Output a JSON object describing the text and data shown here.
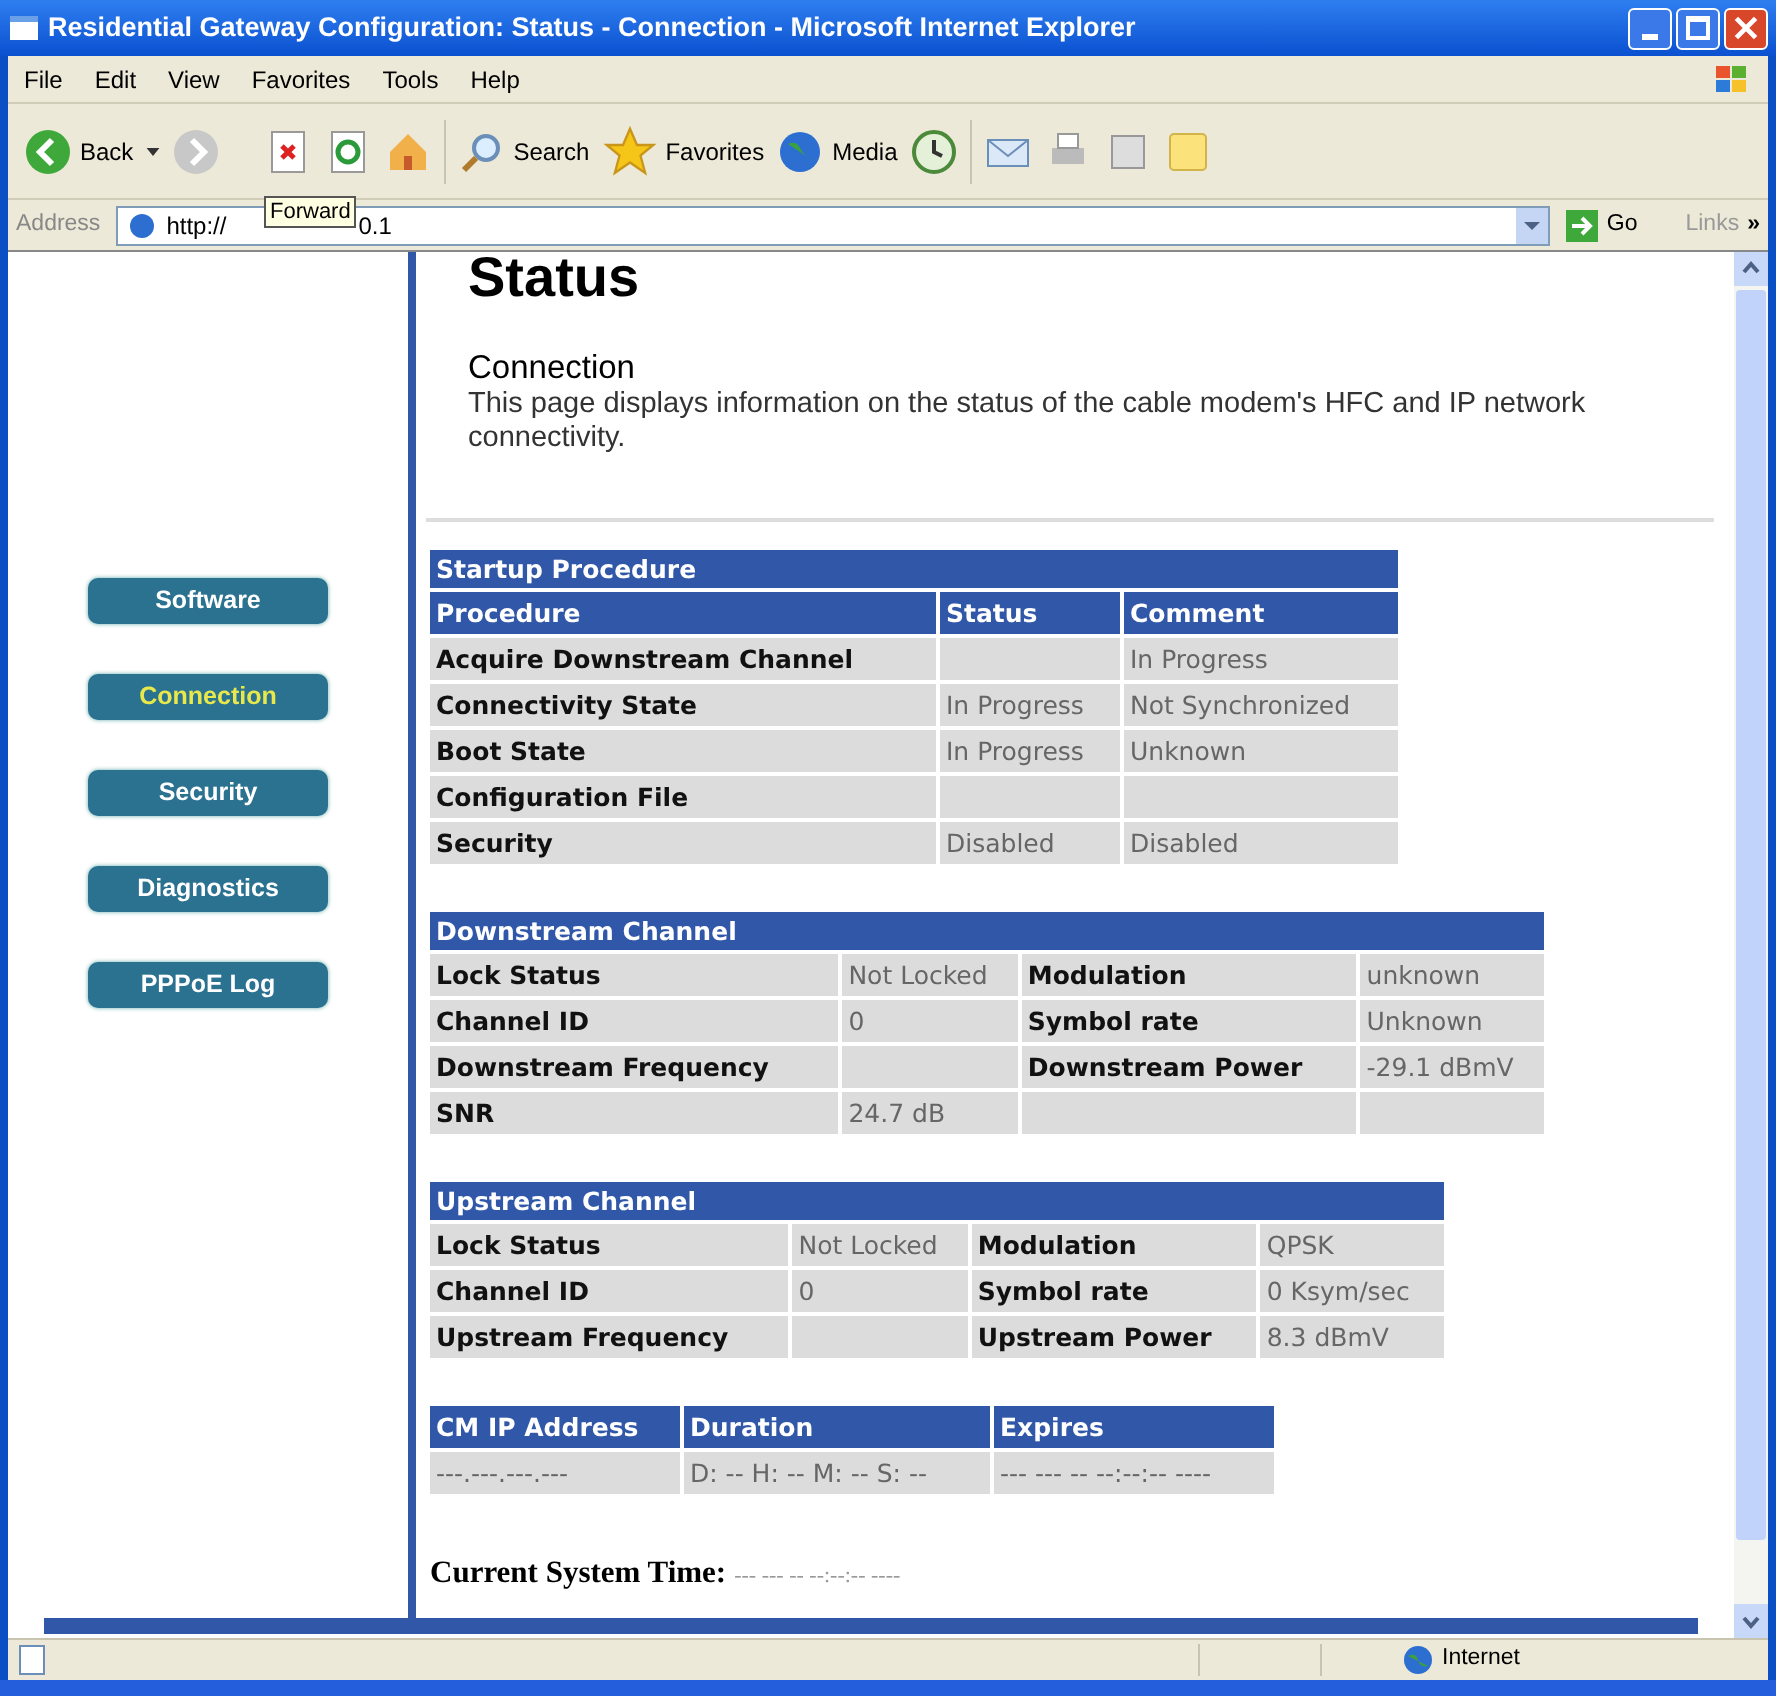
{
  "window": {
    "title": "Residential Gateway Configuration: Status - Connection - Microsoft Internet Explorer"
  },
  "menu": [
    "File",
    "Edit",
    "View",
    "Favorites",
    "Tools",
    "Help"
  ],
  "toolbar": {
    "back": "Back",
    "search": "Search",
    "favorites": "Favorites",
    "media": "Media",
    "tooltip": "Forward"
  },
  "address_bar": {
    "label": "Address",
    "value_start": "http://",
    "value_end": "0.1",
    "go": "Go",
    "links": "Links",
    "more": "»"
  },
  "nav": [
    {
      "label": "Software",
      "selected": false
    },
    {
      "label": "Connection",
      "selected": true
    },
    {
      "label": "Security",
      "selected": false
    },
    {
      "label": "Diagnostics",
      "selected": false
    },
    {
      "label": "PPPoE Log",
      "selected": false
    }
  ],
  "page": {
    "heading": "Status",
    "subheading": "Connection",
    "description": "This page displays information on the status of the cable modem's HFC and IP network connectivity."
  },
  "tables": [
    {
      "kind": "procedure",
      "title": "Startup Procedure",
      "columns": [
        "Procedure",
        "Status",
        "Comment"
      ],
      "rows": [
        [
          "Acquire Downstream Channel",
          null,
          "In Progress"
        ],
        [
          "Connectivity State",
          "In Progress",
          "Not Synchronized"
        ],
        [
          "Boot State",
          "In Progress",
          "Unknown"
        ],
        [
          "Configuration File",
          null,
          null
        ],
        [
          "Security",
          "Disabled",
          "Disabled"
        ]
      ]
    },
    {
      "kind": "pairs",
      "title": "Downstream Channel",
      "rows": [
        [
          "Lock Status",
          "Not Locked",
          "Modulation",
          "unknown"
        ],
        [
          "Channel ID",
          "0",
          "Symbol rate",
          "Unknown"
        ],
        [
          "Downstream Frequency",
          null,
          "Downstream Power",
          "-29.1 dBmV"
        ],
        [
          "SNR",
          "24.7 dB",
          null,
          null
        ]
      ]
    },
    {
      "kind": "pairs",
      "title": "Upstream Channel",
      "rows": [
        [
          "Lock Status",
          "Not Locked",
          "Modulation",
          "QPSK"
        ],
        [
          "Channel ID",
          "0",
          "Symbol rate",
          "0 Ksym/sec"
        ],
        [
          "Upstream Frequency",
          null,
          "Upstream Power",
          "8.3 dBmV"
        ]
      ]
    },
    {
      "kind": "lease",
      "columns": [
        "CM IP Address",
        "Duration",
        "Expires"
      ],
      "rows": [
        [
          "---.---.---.---",
          "D: -- H: -- M: -- S: --",
          "--- --- -- --:--:-- ----"
        ]
      ]
    }
  ],
  "system_time": {
    "label": "Current System Time:",
    "value": "--- --- -- --:--:-- ----"
  },
  "status_bar": {
    "zone": "Internet"
  }
}
